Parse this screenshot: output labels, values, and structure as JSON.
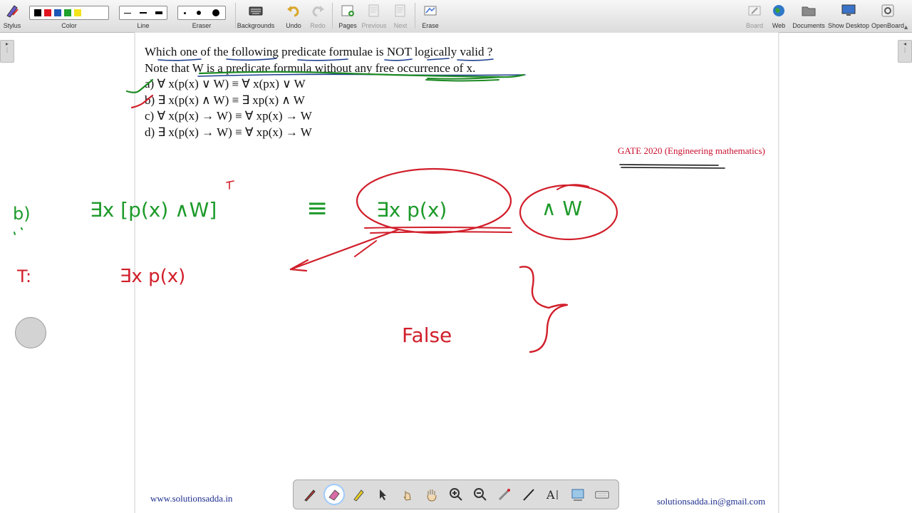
{
  "toolbar": {
    "stylus": "Stylus",
    "color": "Color",
    "line": "Line",
    "eraser": "Eraser",
    "backgrounds": "Backgrounds",
    "undo": "Undo",
    "redo": "Redo",
    "pages": "Pages",
    "previous": "Previous",
    "next": "Next",
    "erase": "Erase",
    "board": "Board",
    "web": "Web",
    "documents": "Documents",
    "show_desktop": "Show Desktop",
    "openboard": "OpenBoard",
    "colors": [
      "#000000",
      "#e0141e",
      "#1d58b8",
      "#1fa12b",
      "#f4e31a"
    ]
  },
  "question": {
    "line1": "Which one of the following predicate formulae is NOT logically valid ?",
    "line2": "Note that W is a predicate formula without any free occurrence of x.",
    "options": [
      "a)  ∀ x(p(x) ∨ W) ≡ ∀ x(px) ∨ W",
      "b)  ∃ x(p(x) ∧ W) ≡ ∃ xp(x) ∧ W",
      "c)  ∀ x(p(x) → W) ≡ ∀ xp(x) → W",
      "d)  ∃ x(p(x) → W) ≡ ∀ xp(x) → W"
    ]
  },
  "source": "GATE 2020 (Engineering mathematics)",
  "footer": {
    "website": "www.solutionsadda.in",
    "email": "solutionsadda.in@gmail.com"
  },
  "handwriting": {
    "label_b": "b)",
    "lhs": "∃x [p(x) ∧W]",
    "equiv": "≡",
    "rhs_part1": "∃x p(x)",
    "rhs_part2": "∧ W",
    "t_label": "T:",
    "t_expr": "∃x p(x)",
    "result": "False"
  },
  "dock": {
    "tools": [
      "pen",
      "eraser",
      "highlighter",
      "selector",
      "interactor",
      "hand",
      "zoom-in",
      "zoom-out",
      "laser",
      "line",
      "text",
      "capture",
      "keyboard"
    ]
  }
}
